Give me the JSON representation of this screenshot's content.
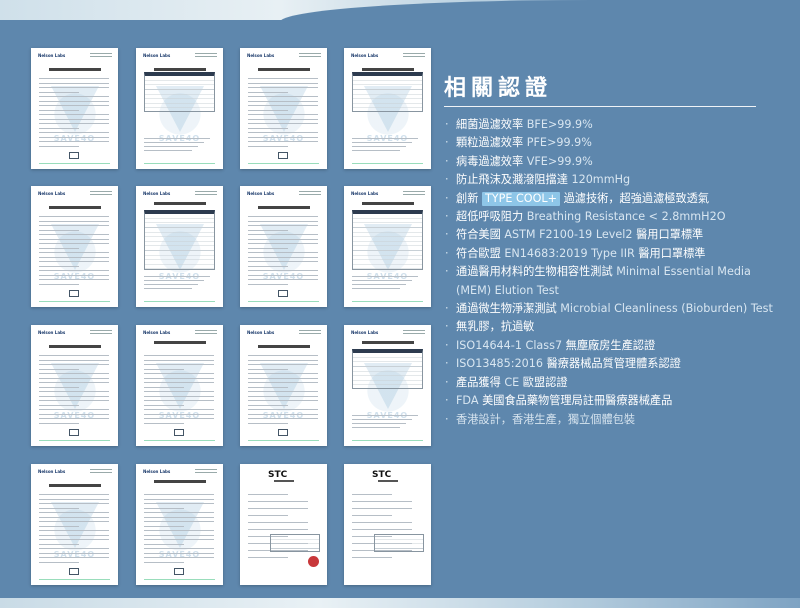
{
  "heading": "相關認證",
  "doc_watermark": "SAVE4O",
  "doc_brand": "Nelson Labs",
  "doc_brand_stc": "STC",
  "certs": [
    {
      "zh": "細菌過濾效率",
      "en": "BFE>99.9%"
    },
    {
      "zh": "顆粒過濾效率",
      "en": "PFE>99.9%"
    },
    {
      "zh": "病毒過濾效率",
      "en": "VFE>99.9%"
    },
    {
      "zh": "防止飛沫及濺潑阻擋達",
      "en": "120mmHg"
    },
    {
      "zh_pre": "創新",
      "tag": "TYPE COOL+",
      "zh_post": "過濾技術，超強過濾極致透氣"
    },
    {
      "zh": "超低呼吸阻力",
      "en": "Breathing Resistance < 2.8mmH2O"
    },
    {
      "zh_pre": "符合美國",
      "en": "ASTM F2100-19 Level2",
      "zh_post": "醫用口罩標準"
    },
    {
      "zh_pre": "符合歐盟",
      "en": "EN14683:2019 Type IIR",
      "zh_post": "醫用口罩標準"
    },
    {
      "zh": "通過醫用材料的生物相容性測試",
      "en": "Minimal Essential Media (MEM) Elution Test"
    },
    {
      "zh": "通過微生物淨潔測試",
      "en": "Microbial Cleanliness (Bioburden) Test"
    },
    {
      "zh": "無乳膠，抗過敏"
    },
    {
      "en": "ISO14644-1 Class7",
      "zh_post": "無塵廠房生產認證"
    },
    {
      "en": "ISO13485:2016",
      "zh_post": "醫療器械品質管理體系認證"
    },
    {
      "zh_pre": "產品獲得",
      "en": "CE",
      "zh_post": "歐盟認證"
    },
    {
      "en": "FDA",
      "zh_post": "美國食品藥物管理局註冊醫療器械產品"
    },
    {
      "zh": "香港設計，香港生產，獨立個體包裝"
    }
  ]
}
